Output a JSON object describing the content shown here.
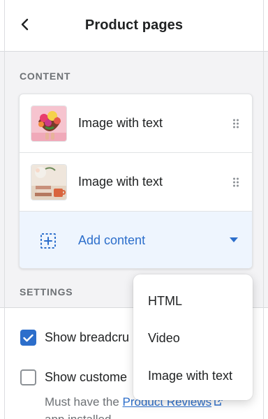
{
  "header": {
    "title": "Product pages",
    "back_icon": "chevron-left-icon"
  },
  "content_section": {
    "label": "CONTENT",
    "items": [
      {
        "label": "Image with text",
        "thumb": "flower-heart-image",
        "handle_icon": "drag-handle-icon"
      },
      {
        "label": "Image with text",
        "thumb": "books-cup-image",
        "handle_icon": "drag-handle-icon"
      }
    ],
    "add": {
      "label": "Add content",
      "icon": "add-section-icon",
      "caret_icon": "caret-down-icon"
    }
  },
  "settings_section": {
    "label": "SETTINGS",
    "options": [
      {
        "label": "Show breadcru",
        "checked": true
      },
      {
        "label": "Show custome",
        "checked": false
      }
    ],
    "help_prefix": "Must have the ",
    "help_link": "Product Reviews",
    "help_suffix": "app installed"
  },
  "dropdown": {
    "items": [
      "HTML",
      "Video",
      "Image with text"
    ]
  },
  "colors": {
    "accent": "#2c6ecb",
    "add_row_bg": "#eef5fe",
    "page_bg": "#f3f3f5",
    "muted_text": "#6d7175"
  }
}
